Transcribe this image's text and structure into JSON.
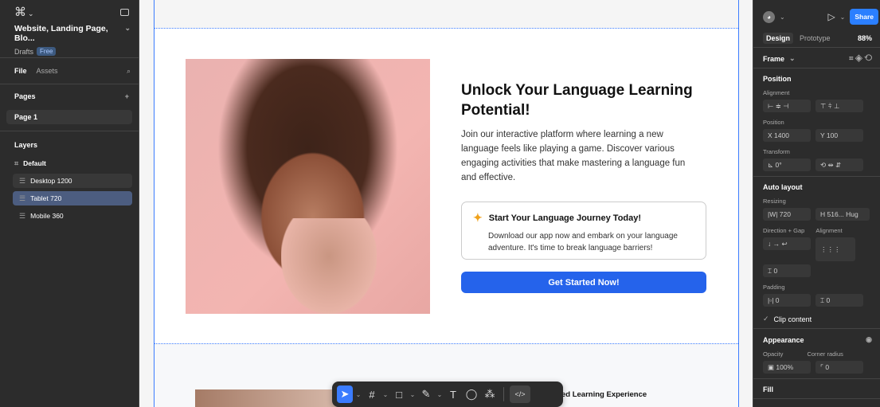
{
  "left": {
    "logo": "⌘",
    "project_title": "Website, Landing Page, Blo...",
    "drafts": "Drafts",
    "plan": "Free",
    "tab_file": "File",
    "tab_assets": "Assets",
    "pages_label": "Pages",
    "page1": "Page 1",
    "layers_label": "Layers",
    "layer_default": "Default",
    "layers": [
      "Desktop 1200",
      "Tablet 720",
      "Mobile 360"
    ]
  },
  "canvas": {
    "headline": "Unlock Your Language Learning Potential!",
    "lead": "Join our interactive platform where learning a new language feels like playing a game. Discover various engaging activities that make mastering a language fun and effective.",
    "card_title": "Start Your Language Journey Today!",
    "card_body": "Download our app now and embark on your language adventure. It's time to break language barriers!",
    "cta": "Get Started Now!",
    "section2_title": "ed Learning Experience"
  },
  "toolbar": {
    "code": "</>"
  },
  "right": {
    "share": "Share",
    "tab_design": "Design",
    "tab_prototype": "Prototype",
    "zoom": "88%",
    "frame": "Frame",
    "position": "Position",
    "alignment": "Alignment",
    "position_label": "Position",
    "x": "X  1400",
    "y": "Y  100",
    "transform": "Transform",
    "rotation": "⊾  0°",
    "auto_layout": "Auto layout",
    "resizing": "Resizing",
    "w": "|W| 720",
    "h": "H  516...  Hug",
    "direction_gap": "Direction + Gap",
    "alignment2": "Alignment",
    "gap": "⌶  0",
    "padding": "Padding",
    "pad_h": "|▫|  0",
    "pad_v": "⌶  0",
    "clip": "Clip content",
    "appearance": "Appearance",
    "opacity_label": "Opacity",
    "radius_label": "Corner radius",
    "opacity": "▣  100%",
    "radius": "⌜  0",
    "fill": "Fill"
  },
  "colors": {
    "accent": "#2563eb",
    "selection": "#4c5d80"
  }
}
